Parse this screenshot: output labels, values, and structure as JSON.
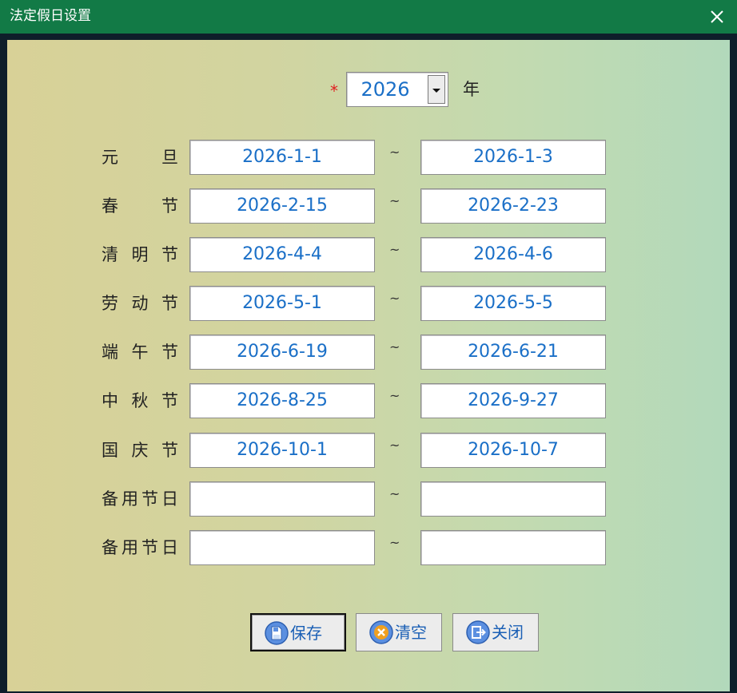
{
  "window": {
    "title": "法定假日设置"
  },
  "year": {
    "required_marker": "*",
    "value": "2026",
    "unit": "年"
  },
  "separator": "~",
  "holidays": [
    {
      "label": "元　　旦",
      "start": "2026-1-1",
      "end": "2026-1-3"
    },
    {
      "label": "春　　节",
      "start": "2026-2-15",
      "end": "2026-2-23"
    },
    {
      "label": "清 明 节",
      "start": "2026-4-4",
      "end": "2026-4-6"
    },
    {
      "label": "劳 动 节",
      "start": "2026-5-1",
      "end": "2026-5-5"
    },
    {
      "label": "端 午 节",
      "start": "2026-6-19",
      "end": "2026-6-21"
    },
    {
      "label": "中 秋 节",
      "start": "2026-8-25",
      "end": "2026-9-27"
    },
    {
      "label": "国 庆 节",
      "start": "2026-10-1",
      "end": "2026-10-7"
    },
    {
      "label": "备用节日",
      "start": "",
      "end": ""
    },
    {
      "label": "备用节日",
      "start": "",
      "end": ""
    }
  ],
  "buttons": {
    "save": {
      "label": "保存",
      "icon": "save-icon"
    },
    "clear": {
      "label": "清空",
      "icon": "clear-icon"
    },
    "close": {
      "label": "关闭",
      "icon": "exit-icon"
    }
  },
  "colors": {
    "titlebar": "#127a46",
    "value_text": "#1a6fc7",
    "required_marker": "#e02020"
  }
}
